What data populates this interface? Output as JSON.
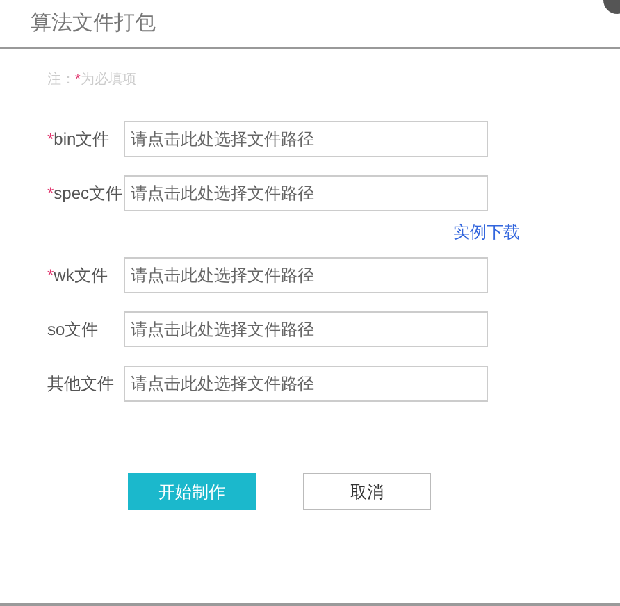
{
  "dialog": {
    "title": "算法文件打包"
  },
  "note": {
    "prefix": "注：",
    "star": "*",
    "text": "为必填项"
  },
  "fields": [
    {
      "label": "bin文件",
      "required": true,
      "placeholder": "请点击此处选择文件路径"
    },
    {
      "label": "spec文件",
      "required": true,
      "placeholder": "请点击此处选择文件路径",
      "link": "实例下载"
    },
    {
      "label": "wk文件",
      "required": true,
      "placeholder": "请点击此处选择文件路径"
    },
    {
      "label": "so文件",
      "required": false,
      "placeholder": "请点击此处选择文件路径"
    },
    {
      "label": "其他文件",
      "required": false,
      "placeholder": "请点击此处选择文件路径"
    }
  ],
  "buttons": [
    {
      "label": "开始制作",
      "kind": "primary"
    },
    {
      "label": "取消",
      "kind": "secondary"
    }
  ]
}
